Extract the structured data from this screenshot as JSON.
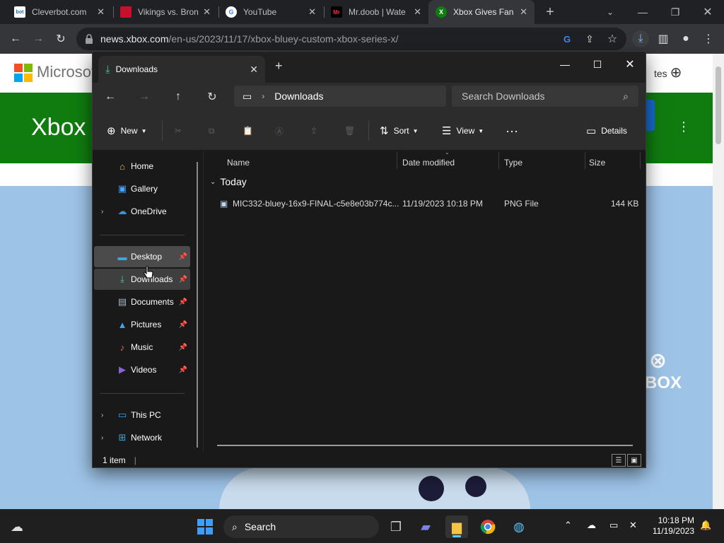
{
  "chrome": {
    "tabs": [
      {
        "title": "Cleverbot.com",
        "icon": "cleverbot-icon",
        "fav_text": "bot"
      },
      {
        "title": "Vikings vs. Bron",
        "icon": "nfl-icon",
        "fav_text": ""
      },
      {
        "title": "YouTube",
        "icon": "google-icon",
        "fav_text": "G"
      },
      {
        "title": "Mr.doob | Wate",
        "icon": "mrdoob-icon",
        "fav_text": "Mr"
      },
      {
        "title": "Xbox Gives Fan",
        "icon": "xbox-icon",
        "fav_text": "X"
      }
    ],
    "new_tab_label": "+",
    "url_host": "news.xbox.com",
    "url_path": "/en-us/2023/11/17/xbox-bluey-custom-xbox-series-x/"
  },
  "webpage": {
    "brand": "Microsoft",
    "hero_title": "Xbox W",
    "right_text": "tes",
    "xbox_logo_text": "BOX"
  },
  "explorer": {
    "tab_title": "Downloads",
    "breadcrumb": "Downloads",
    "search_placeholder": "Search Downloads",
    "cmd": {
      "new": "New",
      "sort": "Sort",
      "view": "View",
      "details": "Details"
    },
    "nav": [
      {
        "label": "Home",
        "icon": "home-icon",
        "glyph": "⌂",
        "color": "#f0b73a",
        "expandable": false,
        "pinned": false
      },
      {
        "label": "Gallery",
        "icon": "gallery-icon",
        "glyph": "▣",
        "color": "#4aa3ff",
        "expandable": false,
        "pinned": false
      },
      {
        "label": "OneDrive",
        "icon": "onedrive-icon",
        "glyph": "☁",
        "color": "#3b8ee8",
        "expandable": true,
        "pinned": false
      },
      {
        "label": "Desktop",
        "icon": "desktop-icon",
        "glyph": "▬",
        "color": "#3da5e0",
        "expandable": false,
        "pinned": true
      },
      {
        "label": "Downloads",
        "icon": "downloads-icon",
        "glyph": "⤓",
        "color": "#4cc2a5",
        "expandable": false,
        "pinned": true
      },
      {
        "label": "Documents",
        "icon": "documents-icon",
        "glyph": "▤",
        "color": "#a9b7c9",
        "expandable": false,
        "pinned": true
      },
      {
        "label": "Pictures",
        "icon": "pictures-icon",
        "glyph": "▲",
        "color": "#3fa4e6",
        "expandable": false,
        "pinned": true
      },
      {
        "label": "Music",
        "icon": "music-icon",
        "glyph": "♪",
        "color": "#e26a5b",
        "expandable": false,
        "pinned": true
      },
      {
        "label": "Videos",
        "icon": "videos-icon",
        "glyph": "▶",
        "color": "#8a62d8",
        "expandable": false,
        "pinned": true
      },
      {
        "label": "This PC",
        "icon": "this-pc-icon",
        "glyph": "▭",
        "color": "#3da5e0",
        "expandable": true,
        "pinned": false
      },
      {
        "label": "Network",
        "icon": "network-icon",
        "glyph": "⊞",
        "color": "#3da5e0",
        "expandable": true,
        "pinned": false
      }
    ],
    "columns": {
      "name": "Name",
      "date": "Date modified",
      "type": "Type",
      "size": "Size"
    },
    "group": "Today",
    "files": [
      {
        "name": "MIC332-bluey-16x9-FINAL-c5e8e03b774c...",
        "date": "11/19/2023 10:18 PM",
        "type": "PNG File",
        "size": "144 KB"
      }
    ],
    "status": "1 item"
  },
  "taskbar": {
    "search_label": "Search",
    "time": "10:18 PM",
    "date": "11/19/2023"
  }
}
